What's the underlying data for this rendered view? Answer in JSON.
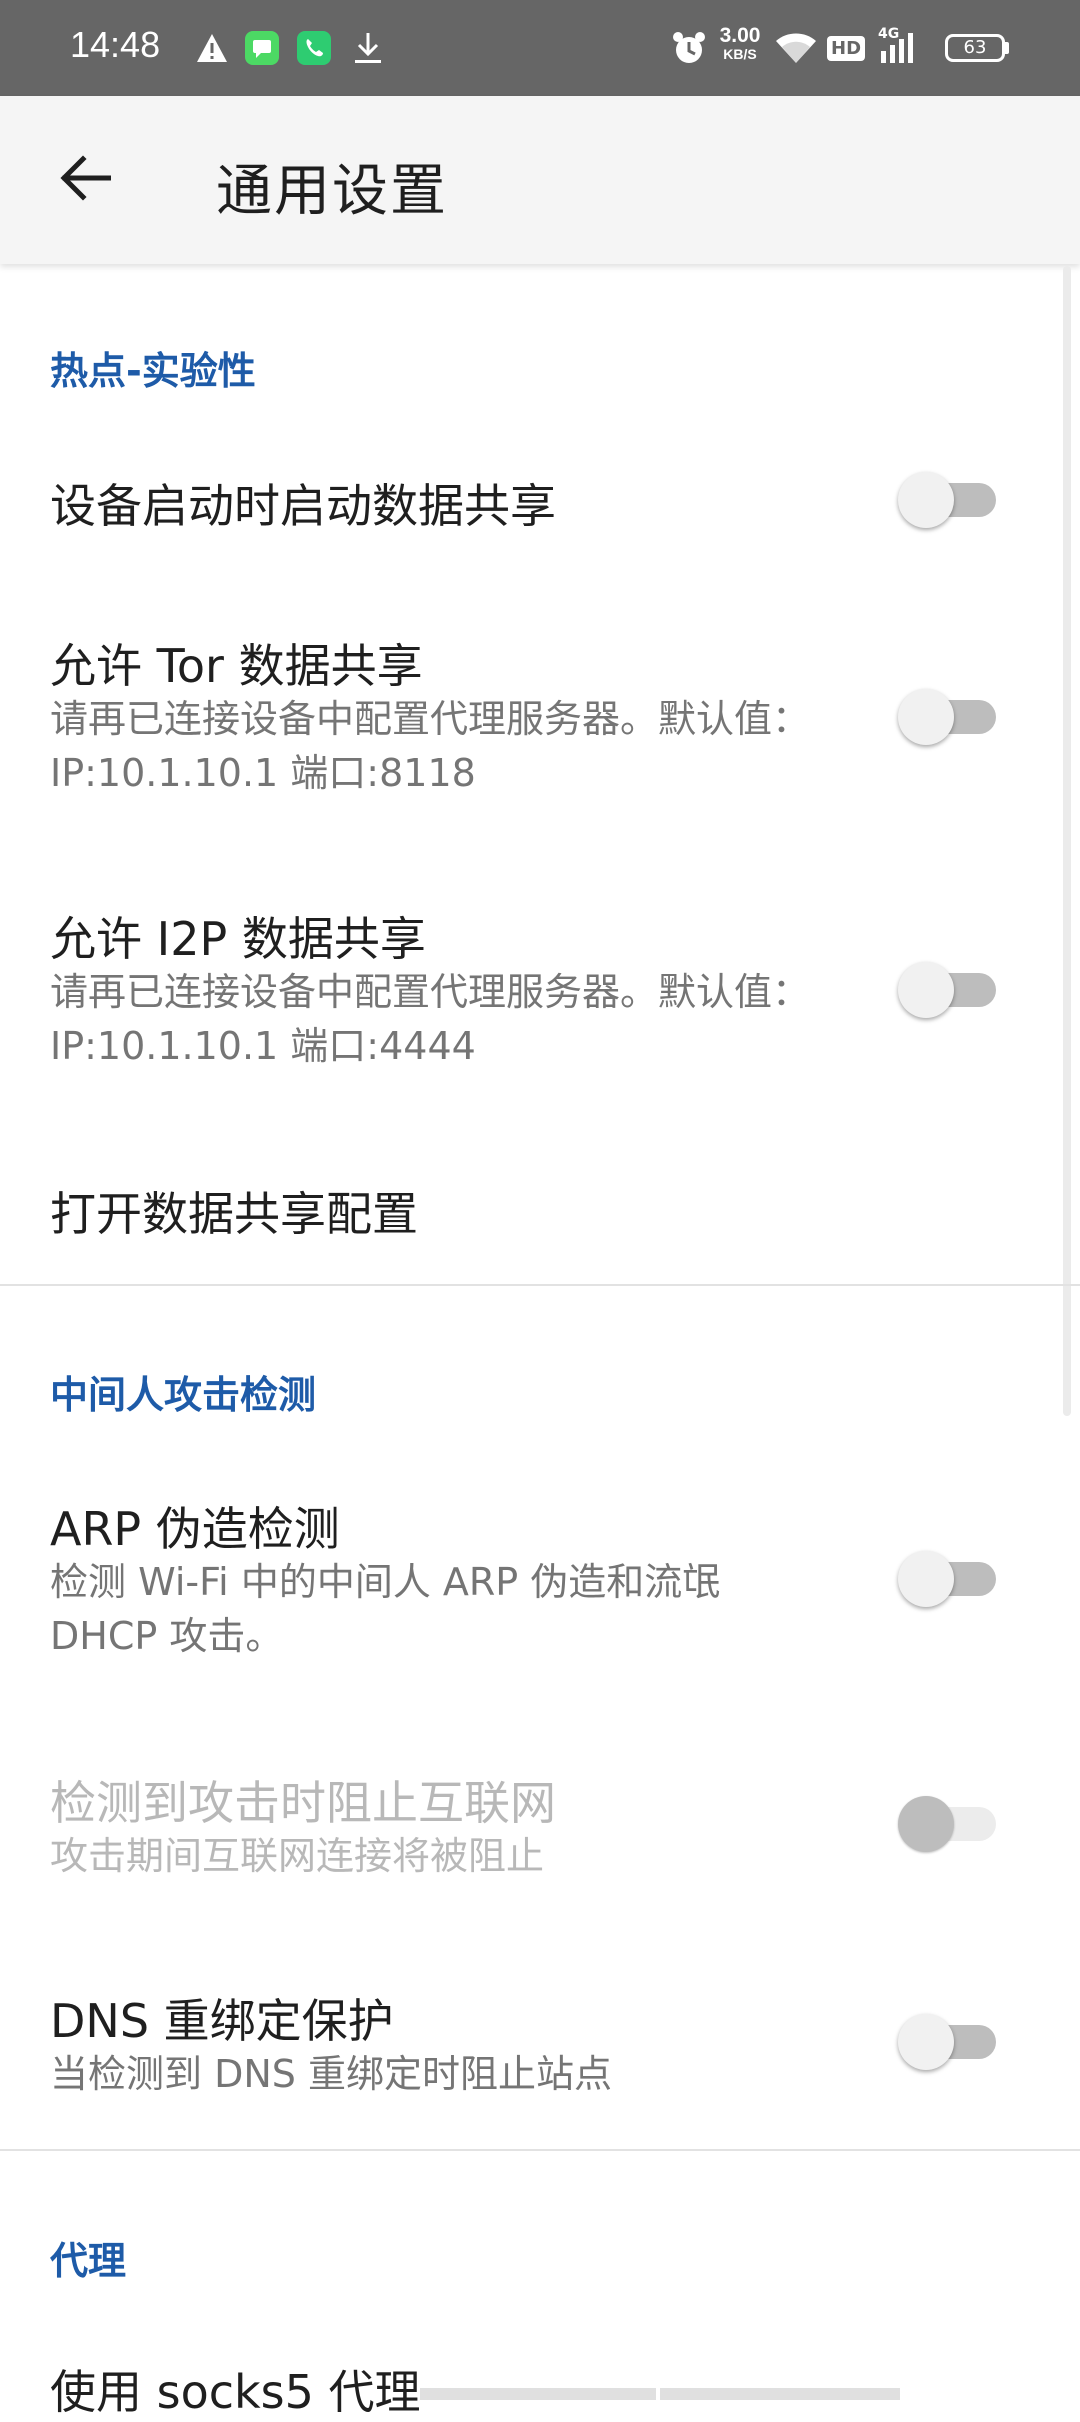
{
  "status_bar": {
    "time": "14:48",
    "net_speed_value": "3.00",
    "net_speed_unit": "KB/S",
    "hd": "HD",
    "network_type": "4G",
    "battery": "63"
  },
  "app_bar": {
    "title": "通用设置"
  },
  "sections": {
    "hotspot": {
      "header": "热点-实验性",
      "boot_start": {
        "title": "设备启动时启动数据共享",
        "checked": false
      },
      "tor": {
        "title": "允许 Tor 数据共享",
        "summary": "请再已连接设备中配置代理服务器。默认值：IP:10.1.10.1 端口:8118",
        "checked": false
      },
      "i2p": {
        "title": "允许 I2P 数据共享",
        "summary": "请再已连接设备中配置代理服务器。默认值：IP:10.1.10.1 端口:4444",
        "checked": false
      },
      "open_config": {
        "title": "打开数据共享配置"
      }
    },
    "mitm": {
      "header": "中间人攻击检测",
      "arp": {
        "title": "ARP 伪造检测",
        "summary": "检测 Wi-Fi 中的中间人 ARP 伪造和流氓 DHCP 攻击。",
        "checked": false
      },
      "block": {
        "title": "检测到攻击时阻止互联网",
        "summary": "攻击期间互联网连接将被阻止",
        "checked": false,
        "enabled": false
      },
      "dns": {
        "title": "DNS 重绑定保护",
        "summary": "当检测到 DNS 重绑定时阻止站点",
        "checked": false
      }
    },
    "proxy": {
      "header": "代理",
      "socks5": {
        "title": "使用 socks5 代理"
      }
    }
  },
  "colors": {
    "accent": "#1e5ba8",
    "status_bar_bg": "#666666",
    "app_bar_bg": "#f5f5f5"
  }
}
